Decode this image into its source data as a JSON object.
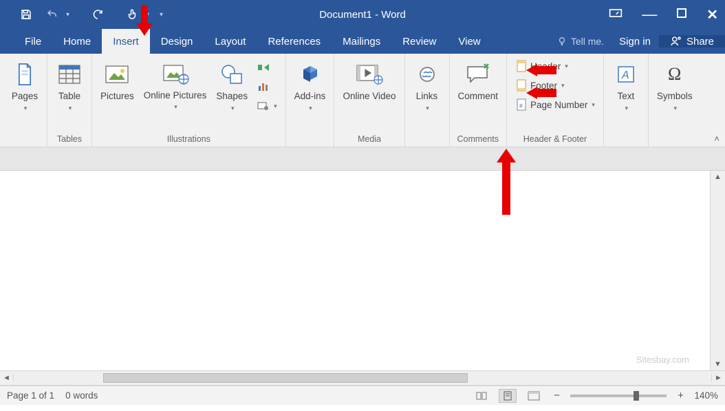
{
  "title": "Document1 - Word",
  "tabs": {
    "file": "File",
    "home": "Home",
    "insert": "Insert",
    "design": "Design",
    "layout": "Layout",
    "references": "References",
    "mailings": "Mailings",
    "review": "Review",
    "view": "View"
  },
  "tell_me": "Tell me.",
  "signin": "Sign in",
  "share": "Share",
  "ribbon": {
    "pages": {
      "label": "Pages"
    },
    "tables": {
      "group": "Tables",
      "table": "Table"
    },
    "illustrations": {
      "group": "Illustrations",
      "pictures": "Pictures",
      "online_pictures": "Online Pictures",
      "shapes": "Shapes"
    },
    "addins": {
      "label": "Add-ins"
    },
    "media": {
      "group": "Media",
      "online_video": "Online Video"
    },
    "links": {
      "label": "Links"
    },
    "comments": {
      "group": "Comments",
      "comment": "Comment"
    },
    "header_footer": {
      "group": "Header & Footer",
      "header": "Header",
      "footer": "Footer",
      "page_number": "Page Number"
    },
    "text": {
      "label": "Text"
    },
    "symbols": {
      "label": "Symbols"
    }
  },
  "watermark": "Sitesbay.com",
  "status": {
    "page": "Page 1 of 1",
    "words": "0 words",
    "zoom": "140%"
  }
}
